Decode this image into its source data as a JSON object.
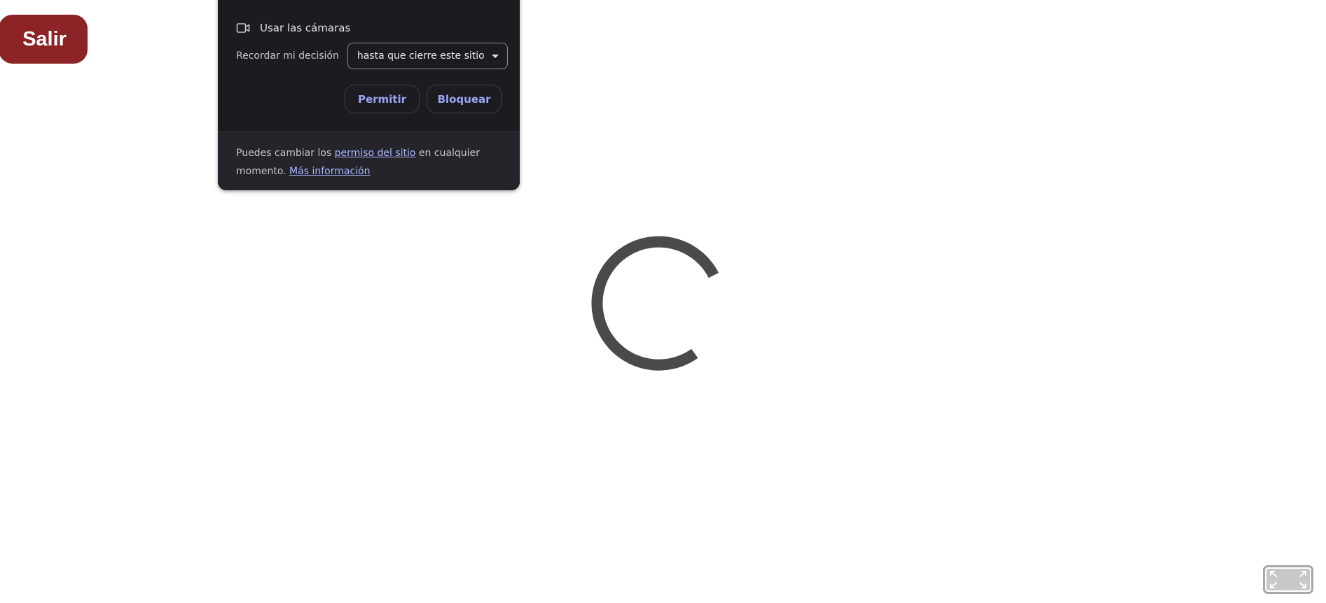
{
  "exit_button": {
    "label": "Salir"
  },
  "permission_popup": {
    "camera_icon": "video-camera-icon",
    "camera_label": "Usar las cámaras",
    "remember_label": "Recordar mi decisión",
    "remember_select": {
      "value": "hasta que cierre este sitio",
      "icon": "caret-down-icon"
    },
    "allow_label": "Permitir",
    "block_label": "Bloquear",
    "footer": {
      "text_before": "Puedes cambiar los ",
      "site_permission_link": "permiso del sitio",
      "text_middle": " en cualquier momento. ",
      "learn_more_link": "Más información"
    }
  },
  "loading": {
    "icon": "loading-spinner-icon"
  },
  "fullscreen": {
    "icon": "fullscreen-expand-icon"
  },
  "colors": {
    "exit_button_bg": "#8c2326",
    "popup_bg": "#1c1b20",
    "link_color": "#aab7ff",
    "button_text": "#98a5f4",
    "spinner": "#4a4a4a"
  }
}
